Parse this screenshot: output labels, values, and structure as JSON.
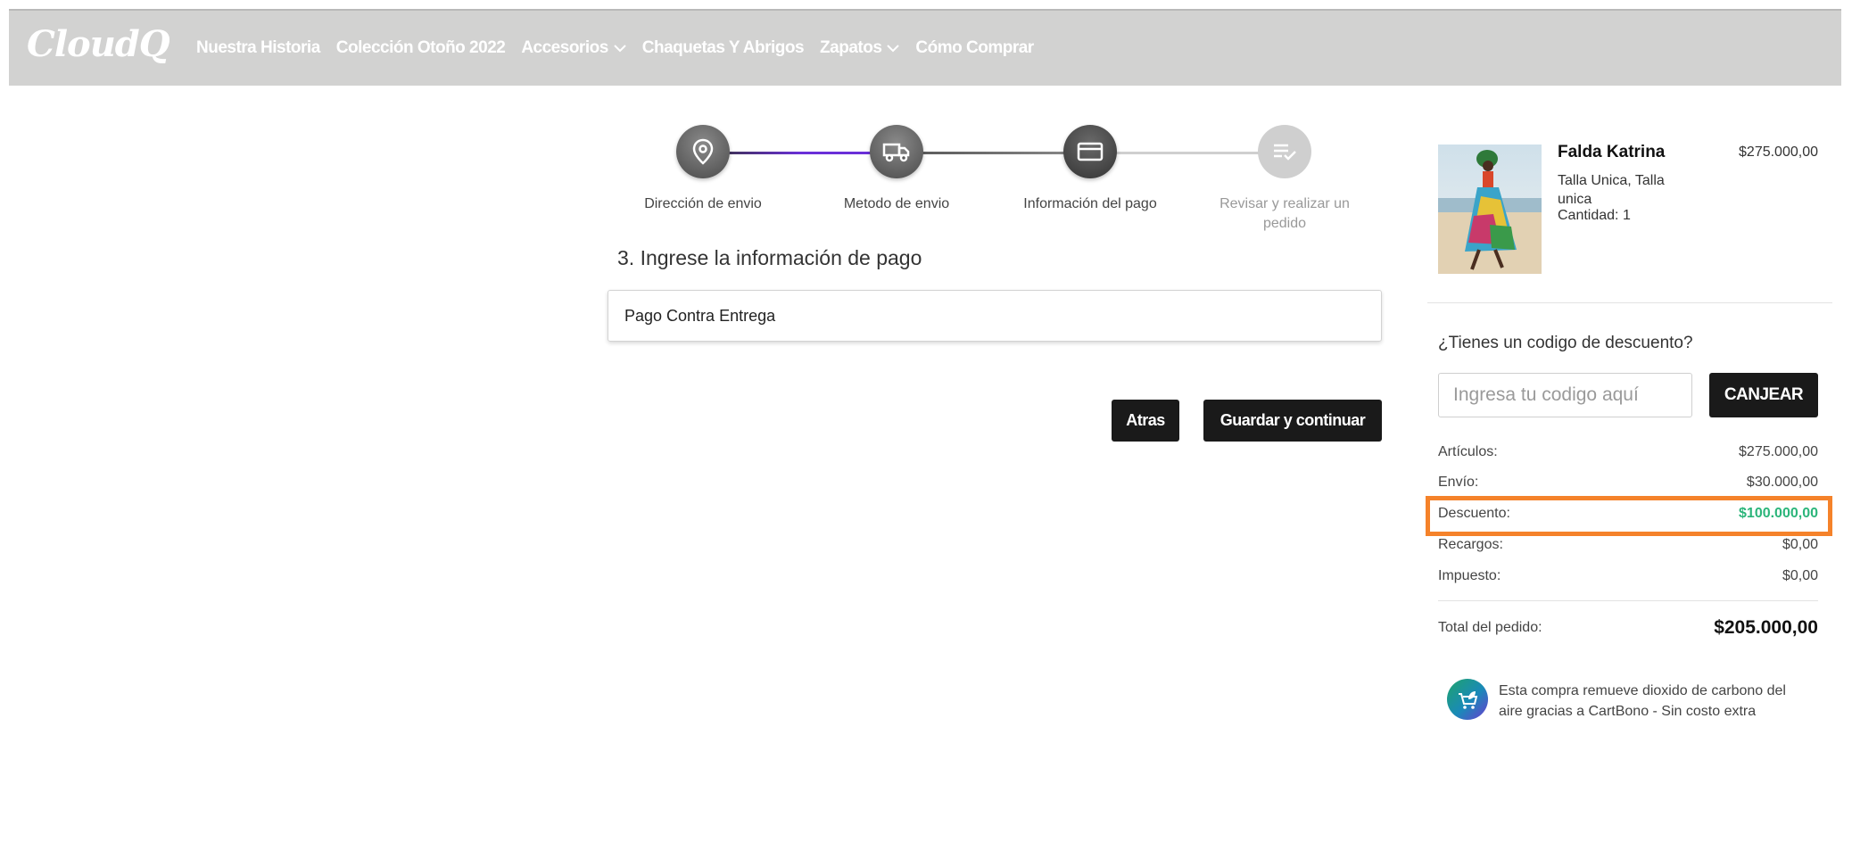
{
  "header": {
    "logo": "CloudQ",
    "nav": [
      {
        "label": "Nuestra Historia",
        "dropdown": false
      },
      {
        "label": "Colección Otoño 2022",
        "dropdown": false
      },
      {
        "label": "Accesorios",
        "dropdown": true
      },
      {
        "label": "Chaquetas Y Abrigos",
        "dropdown": false
      },
      {
        "label": "Zapatos",
        "dropdown": true
      },
      {
        "label": "Cómo Comprar",
        "dropdown": false
      }
    ]
  },
  "checkout": {
    "steps": [
      {
        "label": "Dirección de envio",
        "icon": "location-pin-icon",
        "state": "done"
      },
      {
        "label": "Metodo de envio",
        "icon": "truck-icon",
        "state": "done"
      },
      {
        "label": "Información del pago",
        "icon": "credit-card-icon",
        "state": "current"
      },
      {
        "label": "Revisar y realizar un pedido",
        "icon": "checklist-icon",
        "state": "pending"
      }
    ],
    "section_title": "3. Ingrese la información de pago",
    "payment_method": "Pago Contra Entrega",
    "back_label": "Atras",
    "save_label": "Guardar y continuar"
  },
  "summary": {
    "product": {
      "name": "Falda Katrina",
      "variant": "Talla Unica, Talla unica",
      "quantity": "Cantidad: 1",
      "price": "$275.000,00"
    },
    "coupon": {
      "question": "¿Tienes un codigo de descuento?",
      "placeholder": "Ingresa tu codigo aquí",
      "button": "CANJEAR"
    },
    "rows": {
      "articles": {
        "label": "Artículos:",
        "value": "$275.000,00"
      },
      "shipping": {
        "label": "Envío:",
        "value": "$30.000,00"
      },
      "discount": {
        "label": "Descuento:",
        "value": "$100.000,00"
      },
      "surcharges": {
        "label": "Recargos:",
        "value": "$0,00"
      },
      "tax": {
        "label": "Impuesto:",
        "value": "$0,00"
      }
    },
    "total": {
      "label": "Total del pedido:",
      "value": "$205.000,00"
    },
    "carbon_note": "Esta compra remueve dioxido de carbono del aire gracias a CartBono - Sin costo extra"
  },
  "colors": {
    "header_bg": "#d2d2d1",
    "step_progress": "#6a2fd8",
    "button_bg": "#1a1a1a",
    "discount_value": "#2bb57a",
    "highlight_border": "#f5822a"
  }
}
